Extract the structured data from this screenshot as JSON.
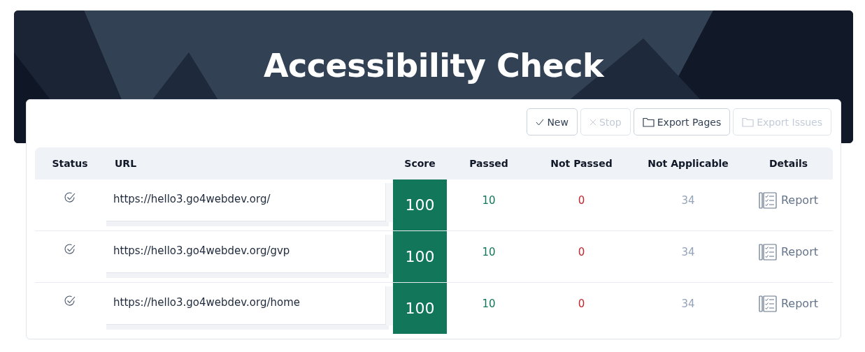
{
  "header": {
    "title": "Accessibility Check"
  },
  "toolbar": [
    {
      "kind": "new",
      "label": "New",
      "disabled": false
    },
    {
      "kind": "stop",
      "label": "Stop",
      "disabled": true
    },
    {
      "kind": "export",
      "label": "Export Pages",
      "disabled": false
    },
    {
      "kind": "export",
      "label": "Export Issues",
      "disabled": true
    }
  ],
  "table": {
    "columns": [
      "Status",
      "URL",
      "Score",
      "Passed",
      "Not Passed",
      "Not Applicable",
      "Details"
    ],
    "rows": [
      {
        "kind": "done",
        "url": "https://hello3.go4webdev.org/",
        "score": "100",
        "passed": "10",
        "not_passed": "0",
        "not_applicable": "34",
        "details": "Report"
      },
      {
        "kind": "done",
        "url": "https://hello3.go4webdev.org/gvp",
        "score": "100",
        "passed": "10",
        "not_passed": "0",
        "not_applicable": "34",
        "details": "Report"
      },
      {
        "kind": "done",
        "url": "https://hello3.go4webdev.org/home",
        "score": "100",
        "passed": "10",
        "not_passed": "0",
        "not_applicable": "34",
        "details": "Report"
      }
    ]
  }
}
